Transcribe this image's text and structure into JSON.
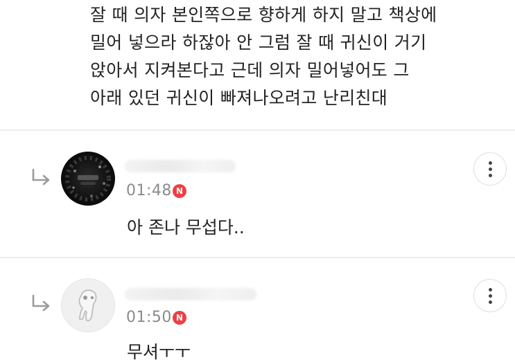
{
  "post": {
    "lines": [
      "잘 때 의자 본인쪽으로 향하게 하지 말고 책상에",
      "밀어 넣으라 하잖아 안 그럼 잘 때 귀신이 거기",
      "앉아서 지켜본다고 근데 의자 밀어넣어도 그",
      "아래 있던 귀신이 빠져나오려고 난리친대"
    ]
  },
  "replies": [
    {
      "time": "01:48",
      "badge": "N",
      "text": "아 존나 무섭다.."
    },
    {
      "time": "01:50",
      "badge": "N",
      "text": "무셔ㅜㅜ"
    }
  ],
  "colors": {
    "badge": "#ef3e42",
    "time": "#8b8b8b",
    "divider": "#ececec"
  },
  "icons": [
    "reply-arrow-icon",
    "more-vertical-icon",
    "new-badge-icon"
  ]
}
